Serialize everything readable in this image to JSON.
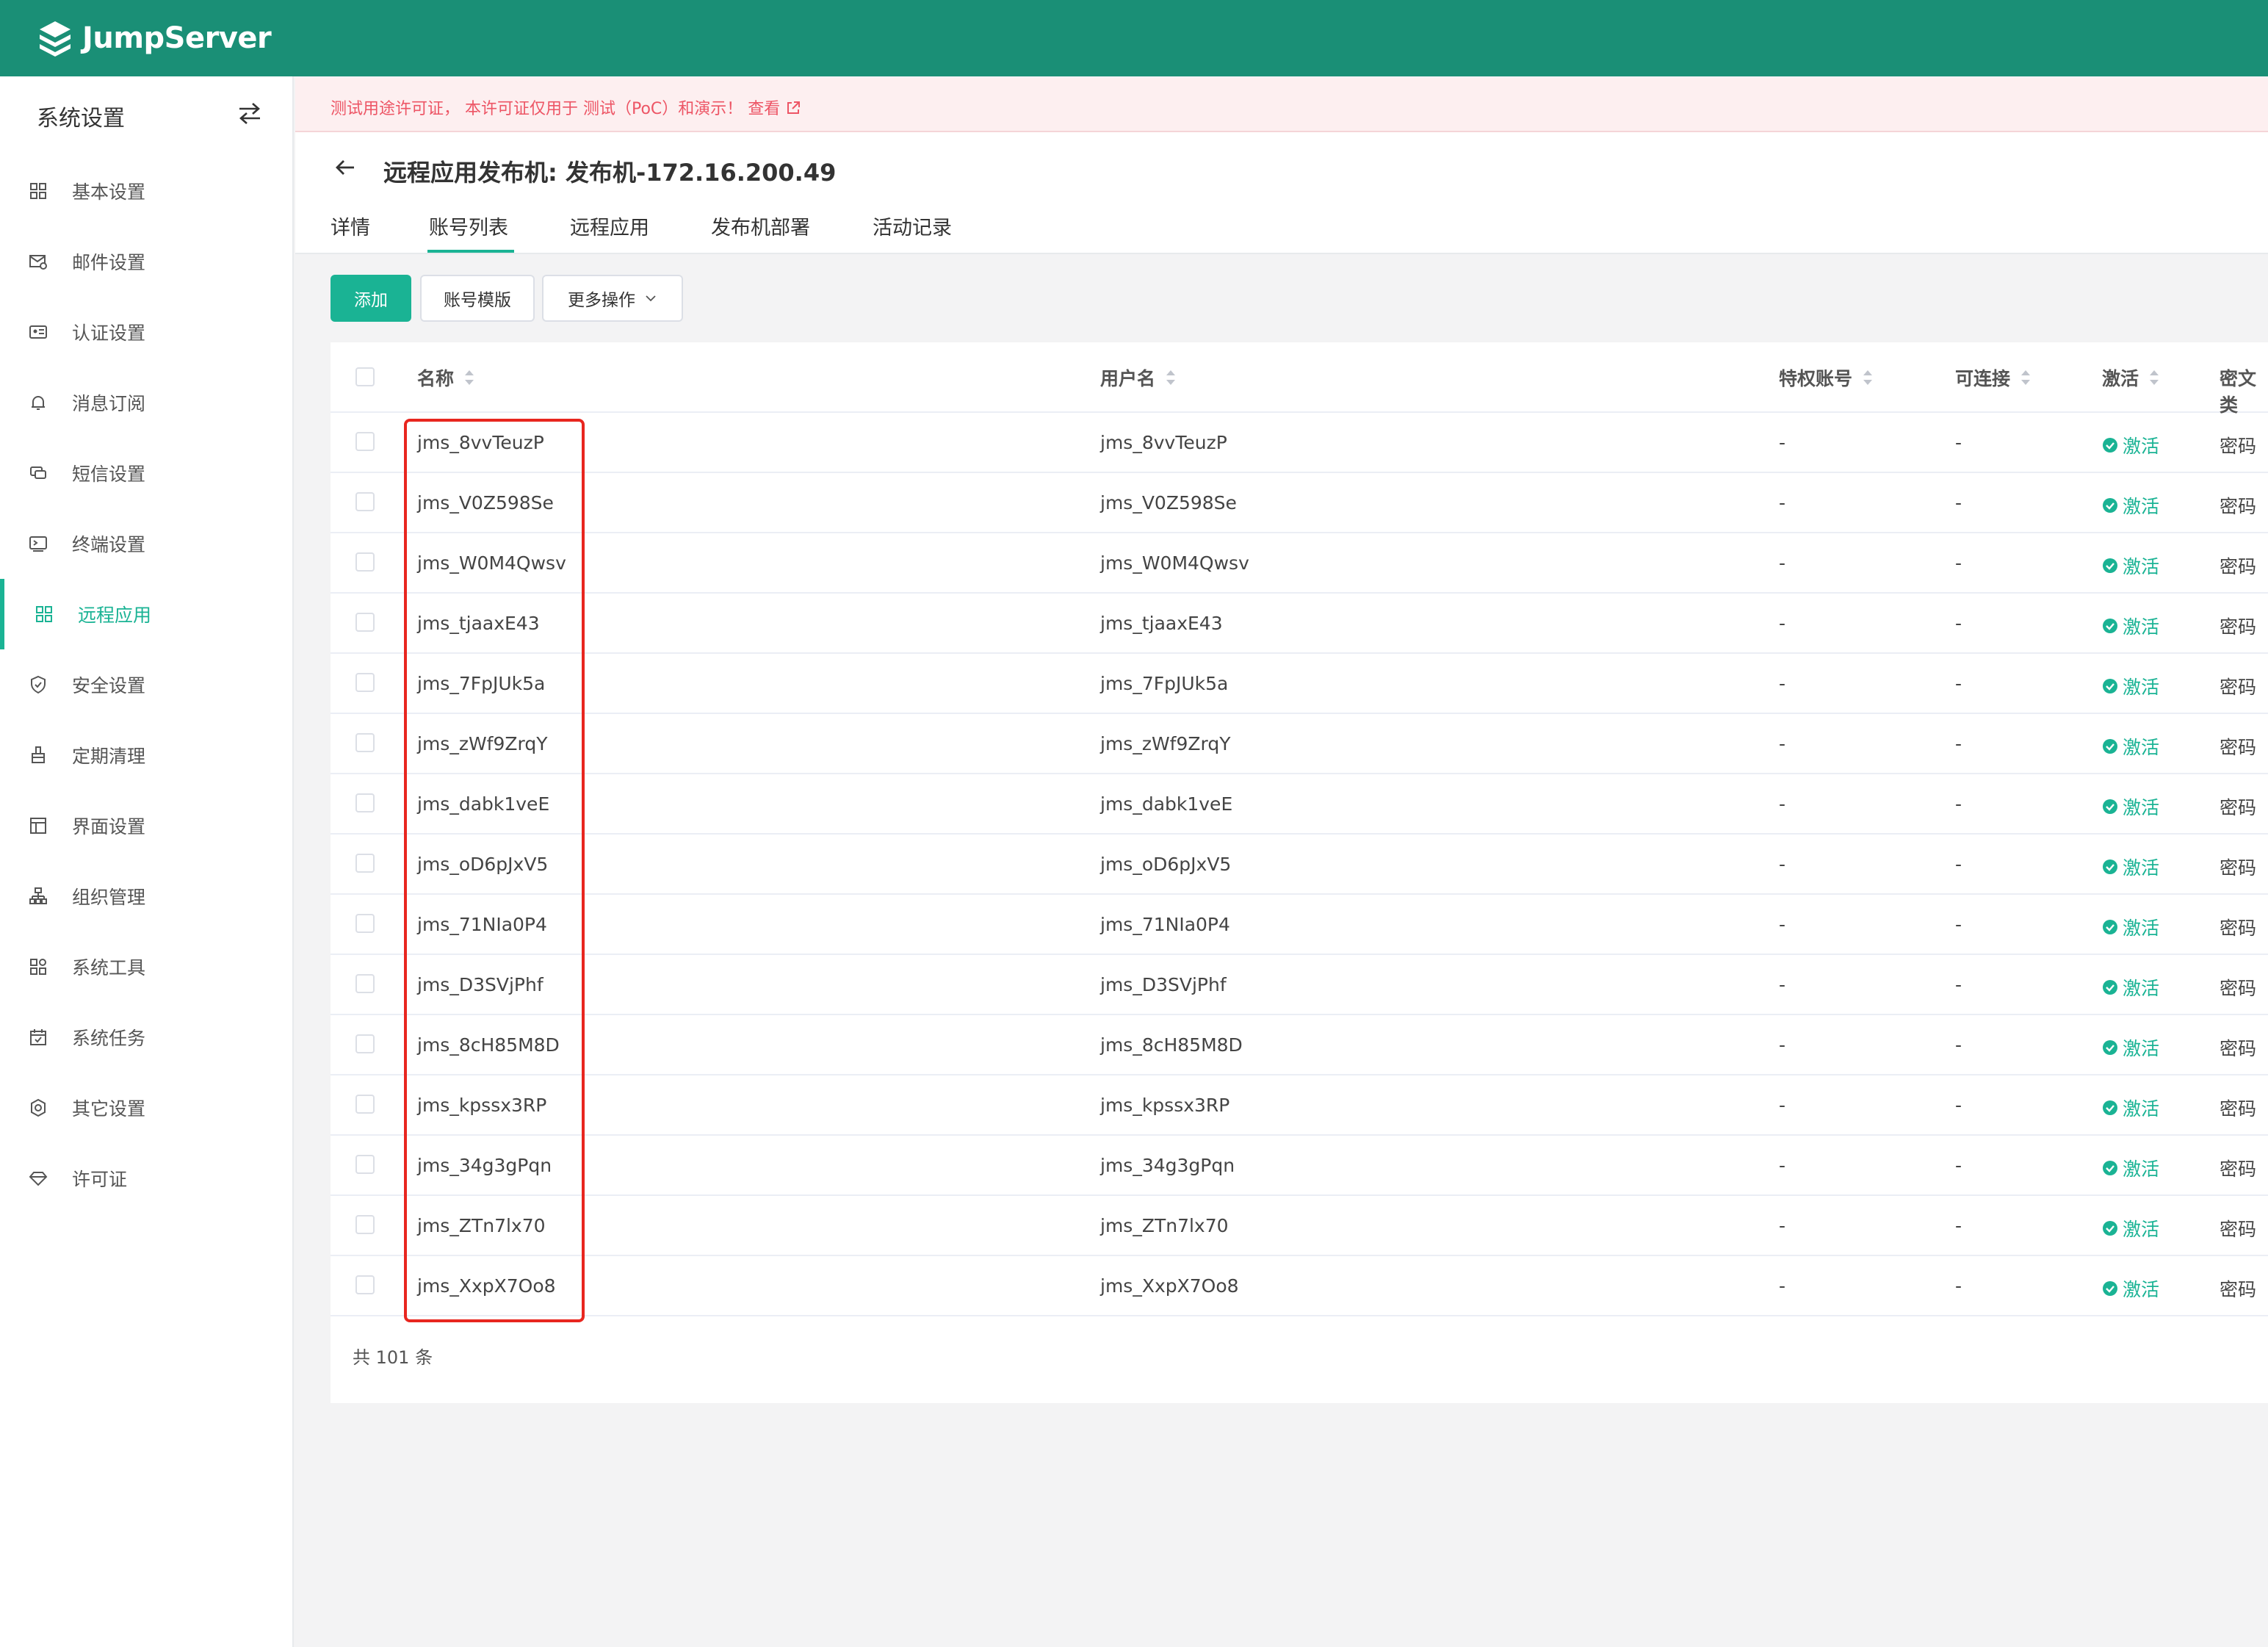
{
  "app": {
    "name": "JumpServer"
  },
  "sidebar": {
    "title": "系统设置",
    "items": [
      {
        "label": "基本设置",
        "icon": "grid-icon"
      },
      {
        "label": "邮件设置",
        "icon": "mail-settings-icon"
      },
      {
        "label": "认证设置",
        "icon": "id-card-icon"
      },
      {
        "label": "消息订阅",
        "icon": "bell-icon"
      },
      {
        "label": "短信设置",
        "icon": "sms-icon"
      },
      {
        "label": "终端设置",
        "icon": "terminal-icon"
      },
      {
        "label": "远程应用",
        "icon": "apps-icon",
        "active": true
      },
      {
        "label": "安全设置",
        "icon": "shield-icon"
      },
      {
        "label": "定期清理",
        "icon": "broom-icon"
      },
      {
        "label": "界面设置",
        "icon": "layout-icon"
      },
      {
        "label": "组织管理",
        "icon": "org-icon"
      },
      {
        "label": "系统工具",
        "icon": "tools-icon"
      },
      {
        "label": "系统任务",
        "icon": "calendar-icon"
      },
      {
        "label": "其它设置",
        "icon": "gear-icon"
      },
      {
        "label": "许可证",
        "icon": "diamond-icon"
      }
    ]
  },
  "banner": {
    "text": "测试用途许可证， 本许可证仅用于 测试（PoC）和演示！ ",
    "link_label": "查看"
  },
  "header": {
    "title": "远程应用发布机: 发布机-172.16.200.49",
    "tabs": [
      {
        "label": "详情"
      },
      {
        "label": "账号列表",
        "active": true
      },
      {
        "label": "远程应用"
      },
      {
        "label": "发布机部署"
      },
      {
        "label": "活动记录"
      }
    ]
  },
  "toolbar": {
    "add_label": "添加",
    "template_label": "账号模版",
    "more_label": "更多操作"
  },
  "table": {
    "columns": [
      "名称",
      "用户名",
      "特权账号",
      "可连接",
      "激活",
      "密文类"
    ],
    "rows": [
      {
        "name": "jms_8vvTeuzP",
        "username": "jms_8vvTeuzP",
        "privileged": "-",
        "connectable": "-",
        "active": "激活",
        "secret_type": "密码"
      },
      {
        "name": "jms_V0Z598Se",
        "username": "jms_V0Z598Se",
        "privileged": "-",
        "connectable": "-",
        "active": "激活",
        "secret_type": "密码"
      },
      {
        "name": "jms_W0M4Qwsv",
        "username": "jms_W0M4Qwsv",
        "privileged": "-",
        "connectable": "-",
        "active": "激活",
        "secret_type": "密码"
      },
      {
        "name": "jms_tjaaxE43",
        "username": "jms_tjaaxE43",
        "privileged": "-",
        "connectable": "-",
        "active": "激活",
        "secret_type": "密码"
      },
      {
        "name": "jms_7FpJUk5a",
        "username": "jms_7FpJUk5a",
        "privileged": "-",
        "connectable": "-",
        "active": "激活",
        "secret_type": "密码"
      },
      {
        "name": "jms_zWf9ZrqY",
        "username": "jms_zWf9ZrqY",
        "privileged": "-",
        "connectable": "-",
        "active": "激活",
        "secret_type": "密码"
      },
      {
        "name": "jms_dabk1veE",
        "username": "jms_dabk1veE",
        "privileged": "-",
        "connectable": "-",
        "active": "激活",
        "secret_type": "密码"
      },
      {
        "name": "jms_oD6pJxV5",
        "username": "jms_oD6pJxV5",
        "privileged": "-",
        "connectable": "-",
        "active": "激活",
        "secret_type": "密码"
      },
      {
        "name": "jms_71NIa0P4",
        "username": "jms_71NIa0P4",
        "privileged": "-",
        "connectable": "-",
        "active": "激活",
        "secret_type": "密码"
      },
      {
        "name": "jms_D3SVjPhf",
        "username": "jms_D3SVjPhf",
        "privileged": "-",
        "connectable": "-",
        "active": "激活",
        "secret_type": "密码"
      },
      {
        "name": "jms_8cH85M8D",
        "username": "jms_8cH85M8D",
        "privileged": "-",
        "connectable": "-",
        "active": "激活",
        "secret_type": "密码"
      },
      {
        "name": "jms_kpssx3RP",
        "username": "jms_kpssx3RP",
        "privileged": "-",
        "connectable": "-",
        "active": "激活",
        "secret_type": "密码"
      },
      {
        "name": "jms_34g3gPqn",
        "username": "jms_34g3gPqn",
        "privileged": "-",
        "connectable": "-",
        "active": "激活",
        "secret_type": "密码"
      },
      {
        "name": "jms_ZTn7lx70",
        "username": "jms_ZTn7lx70",
        "privileged": "-",
        "connectable": "-",
        "active": "激活",
        "secret_type": "密码"
      },
      {
        "name": "jms_XxpX7Oo8",
        "username": "jms_XxpX7Oo8",
        "privileged": "-",
        "connectable": "-",
        "active": "激活",
        "secret_type": "密码"
      }
    ],
    "total_text": "共 101 条"
  },
  "colors": {
    "topbar": "#1a8f76",
    "accent": "#1ab394",
    "banner_text": "#ed5565",
    "highlight_box": "#e8261f"
  }
}
